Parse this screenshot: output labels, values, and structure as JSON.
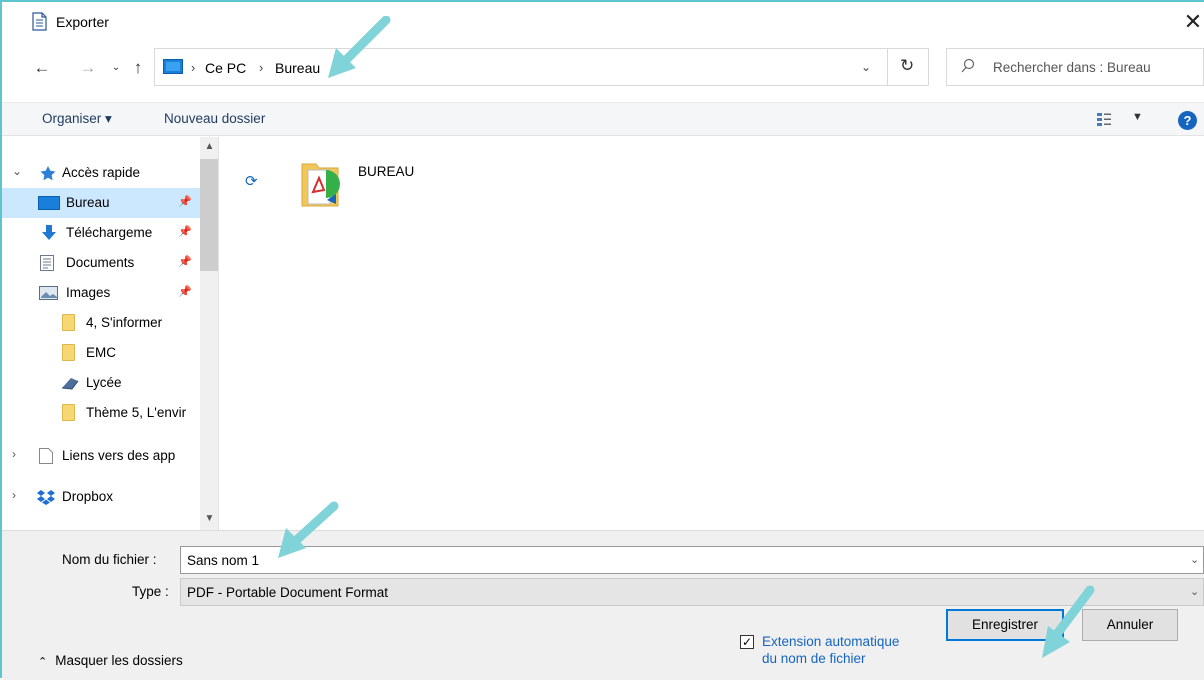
{
  "window": {
    "title": "Exporter"
  },
  "address": {
    "crumbs": [
      "Ce PC",
      "Bureau"
    ],
    "search_placeholder": "Rechercher dans : Bureau"
  },
  "toolbar": {
    "organize": "Organiser ▾",
    "new_folder": "Nouveau dossier",
    "help": "?"
  },
  "sidebar": {
    "items": [
      {
        "label": "Accès rapide",
        "icon": "star-icon"
      },
      {
        "label": "Bureau",
        "icon": "desktop-icon",
        "pinned": true,
        "selected": true
      },
      {
        "label": "Téléchargeme",
        "icon": "download-icon",
        "pinned": true
      },
      {
        "label": "Documents",
        "icon": "documents-icon",
        "pinned": true
      },
      {
        "label": "Images",
        "icon": "images-icon",
        "pinned": true
      },
      {
        "label": "4, S'informer",
        "icon": "folder-icon"
      },
      {
        "label": "EMC",
        "icon": "folder-icon"
      },
      {
        "label": "Lycée",
        "icon": "onedrive-icon"
      },
      {
        "label": "Thème 5, L'envir",
        "icon": "folder-icon"
      },
      {
        "label": "Liens vers des app",
        "icon": "file-icon"
      },
      {
        "label": "Dropbox",
        "icon": "dropbox-icon"
      }
    ]
  },
  "content": {
    "files": [
      {
        "name": "BUREAU",
        "icon": "pdf-folder-icon"
      }
    ]
  },
  "bottom": {
    "filename_label": "Nom du fichier :",
    "filename_value": "Sans nom 1",
    "type_label": "Type :",
    "type_value": "PDF - Portable Document Format",
    "hide_folders": "Masquer les dossiers",
    "ext_line1": "Extension automatique",
    "ext_line2": "du nom de fichier",
    "save": "Enregistrer",
    "cancel": "Annuler"
  },
  "colors": {
    "accent": "#0078d7",
    "selected_bg": "#cce8ff",
    "annotation_arrow": "#7fd3d9"
  }
}
